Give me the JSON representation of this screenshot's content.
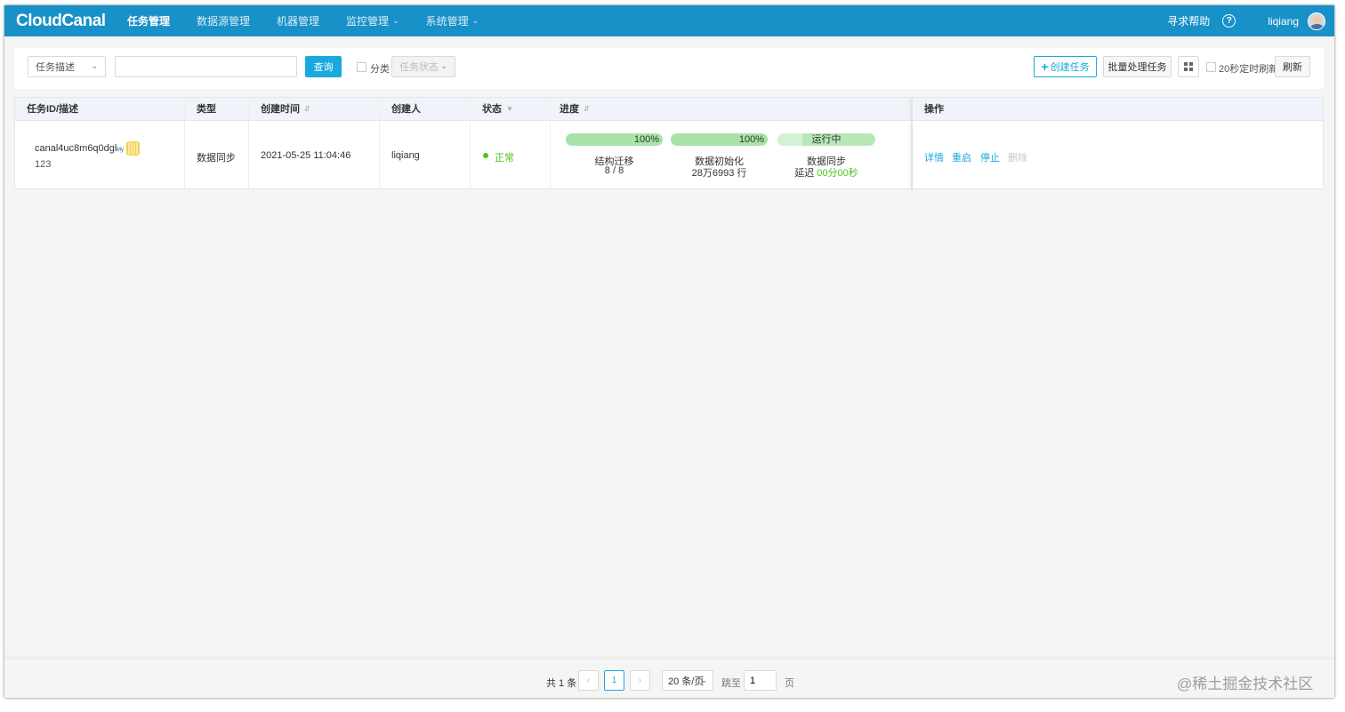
{
  "app": {
    "logo": "CloudCanal",
    "nav": [
      {
        "label": "任务管理",
        "active": true,
        "dropdown": false
      },
      {
        "label": "数据源管理",
        "active": false,
        "dropdown": false
      },
      {
        "label": "机器管理",
        "active": false,
        "dropdown": false
      },
      {
        "label": "监控管理",
        "active": false,
        "dropdown": true
      },
      {
        "label": "系统管理",
        "active": false,
        "dropdown": true
      }
    ],
    "help_label": "寻求帮助",
    "help_icon": "?",
    "username": "liqiang"
  },
  "toolbar": {
    "search_field_select": "任务描述",
    "search_placeholder": "",
    "query_label": "查询",
    "category_label": "分类",
    "task_status_placeholder": "任务状态",
    "create_label": "创建任务",
    "batch_label": "批量处理任务",
    "auto_refresh_label": "20秒定时刷新",
    "refresh_label": "刷新"
  },
  "table": {
    "headers": {
      "id": "任务ID/描述",
      "type": "类型",
      "created": "创建时间",
      "creator": "创建人",
      "status": "状态",
      "progress": "进度",
      "actions": "操作"
    },
    "rows": [
      {
        "id": "canal4uc8m6q0dgl",
        "desc": "123",
        "db_icon_label": "My",
        "type": "数据同步",
        "created": "2021-05-25 11:04:46",
        "creator": "liqiang",
        "status": "正常",
        "progress": {
          "structure": {
            "pct": "100%",
            "label": "结构迁移",
            "detail": "8 / 8"
          },
          "init": {
            "pct": "100%",
            "label": "数据初始化",
            "detail": "28万6993 行"
          },
          "sync": {
            "state": "运行中",
            "label": "数据同步",
            "delay_prefix": "延迟",
            "delay_value": "00分00秒"
          }
        },
        "actions": {
          "detail": "详情",
          "restart": "重启",
          "stop": "停止",
          "delete": "删除"
        }
      }
    ]
  },
  "pagination": {
    "total": "共 1 条",
    "prev": "‹",
    "current_page": "1",
    "next": "›",
    "page_size": "20 条/页",
    "jump_label": "跳至",
    "jump_value": "1",
    "page_suffix": "页"
  },
  "watermark": "@稀土掘金技术社区",
  "colors": {
    "nav_bg": "#1890c8",
    "accent": "#1ba8df",
    "success": "#52c41a",
    "progress_bar": "#a8e4a8"
  }
}
